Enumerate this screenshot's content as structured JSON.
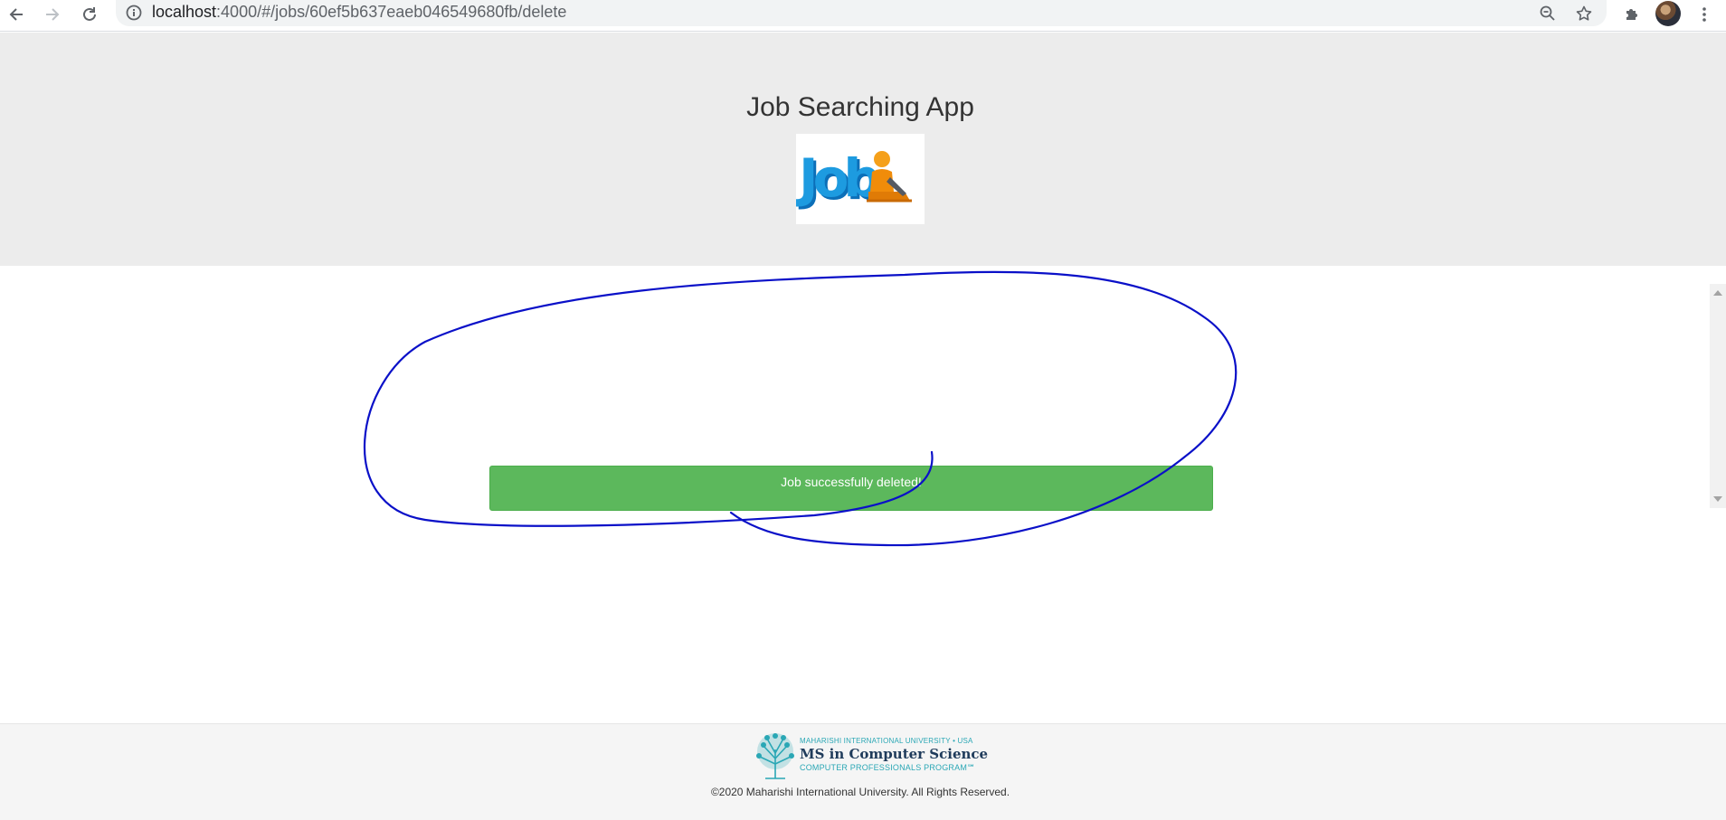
{
  "browser": {
    "url_host": "localhost",
    "url_path": ":4000/#/jobs/60ef5b637eaeb046549680fb/delete"
  },
  "header": {
    "title": "Job Searching App",
    "logo_alt": "Job"
  },
  "main": {
    "alert_message": "Job successfully deleted!"
  },
  "footer": {
    "university_line": "MAHARISHI INTERNATIONAL UNIVERSITY • USA",
    "program_title": "MS in Computer Science",
    "program_subtitle": "COMPUTER PROFESSIONALS PROGRAM℠",
    "copyright": "©2020 Maharishi International University. All Rights Reserved."
  },
  "colors": {
    "header_bg": "#ececec",
    "alert_success": "#5cb85c",
    "annotation_ink": "#0000cc",
    "footer_bg": "#f5f5f5"
  },
  "icons": [
    "back-arrow-icon",
    "forward-arrow-icon",
    "reload-icon",
    "info-icon",
    "zoom-out-icon",
    "bookmark-star-icon",
    "extensions-puzzle-icon",
    "menu-kebab-icon"
  ]
}
